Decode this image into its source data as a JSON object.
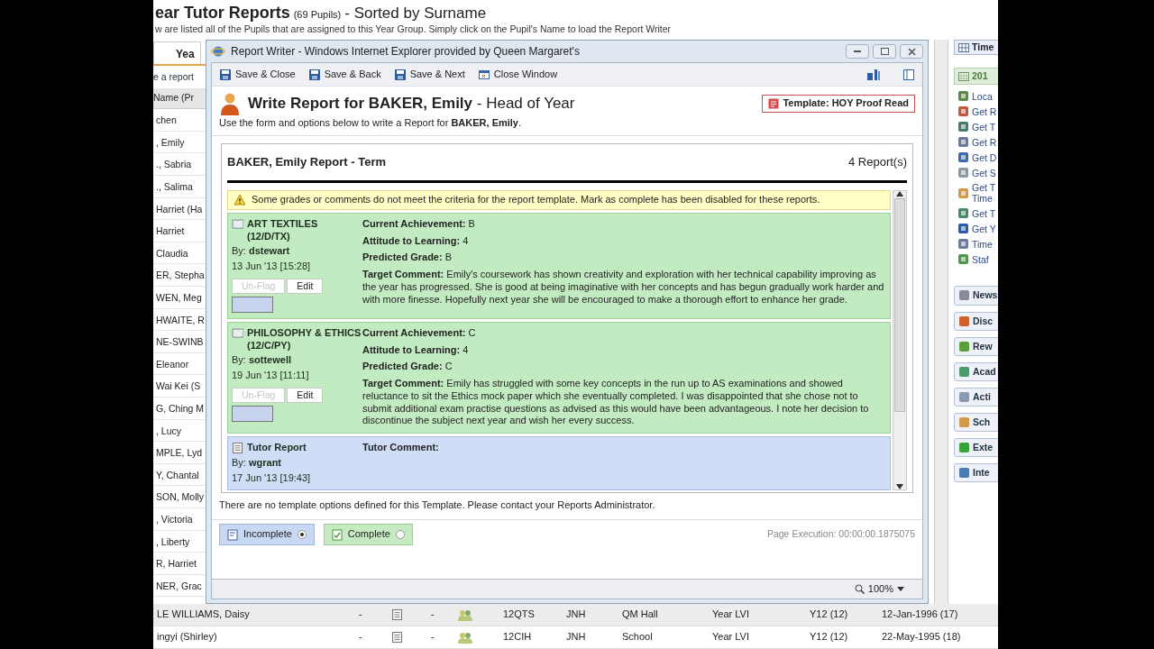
{
  "background_page": {
    "title": "ear Tutor Reports",
    "pupil_count": "(69 Pupils)",
    "sort_note": "- Sorted by Surname",
    "instructions": "w are listed all of the Pupils that are assigned to this Year Group. Simply click on the Pupil's Name to load the Report Writer",
    "tab": "Yea",
    "report_link": "e a report",
    "name_column": "Name (Pr",
    "names": [
      "chen",
      ", Emily",
      "., Sabria",
      "., Salima",
      "Harriet (Ha",
      "Harriet",
      "Claudia",
      "ER, Stepha",
      "WEN, Meg",
      "HWAITE, R",
      "NE-SWINB",
      "Eleanor",
      "Wai Kei (S",
      "G, Ching M",
      ", Lucy",
      "MPLE, Lyd",
      "Y, Chantal",
      "SON, Molly",
      ", Victoria",
      ", Liberty",
      "R, Harriet",
      "NER, Grac"
    ],
    "rows": [
      {
        "selected": true,
        "cells": [
          "LE WILLIAMS, Daisy",
          "-",
          "-",
          "12QTS",
          "JNH",
          "QM Hall",
          "Year LVI",
          "Y12 (12)",
          "12-Jan-1996 (17)"
        ]
      },
      {
        "selected": false,
        "cells": [
          "ingyi (Shirley)",
          "-",
          "-",
          "12CIH",
          "JNH",
          "School",
          "Year LVI",
          "Y12 (12)",
          "22-May-1995 (18)"
        ]
      }
    ]
  },
  "report_window": {
    "title": "Report Writer - Windows Internet Explorer provided by Queen Margaret's",
    "toolbar": [
      {
        "label": "Save & Close",
        "kind": "save"
      },
      {
        "label": "Save & Back",
        "kind": "save"
      },
      {
        "label": "Save & Next",
        "kind": "save"
      },
      {
        "label": "Close Window",
        "kind": "close"
      }
    ],
    "heading": "**Write Report for BAKER, Emily** - Head of Year",
    "template_button": "Template: HOY Proof Read",
    "intro": "Use the form and options below to write a Report for **BAKER, Emily**.",
    "report_panel": {
      "title": "BAKER, Emily Report - Term",
      "count": "4  Report(s)",
      "warning": "Some grades or comments do not meet the criteria for the report template. Mark as complete has been disabled for these reports.",
      "entries": [
        {
          "kind": "subject",
          "title": "ART TEXTILES (12/D/TX)",
          "by": "By: **dstewart**",
          "date": "13 Jun '13 [15:28]",
          "flag_button": {
            "label": "Un-Flag",
            "disabled": true
          },
          "edit_button": "Edit",
          "fields": [
            {
              "label": "Current Achievement:",
              "value": "B"
            },
            {
              "label": "Attitude to Learning:",
              "value": "4"
            },
            {
              "label": "Predicted Grade:",
              "value": "B"
            },
            {
              "label": "Target Comment:",
              "value": "Emily's coursework has shown creativity and exploration with her technical capability improving as the year has progressed. She is good at being imaginative with her concepts and has begun gradually work harder and with more finesse. Hopefully next year she will be encouraged to make a thorough effort to enhance her grade."
            }
          ]
        },
        {
          "kind": "subject",
          "title": "PHILOSOPHY & ETHICS (12/C/PY)",
          "by": "By: **sottewell**",
          "date": "19 Jun '13 [11:11]",
          "flag_button": {
            "label": "Un-Flag",
            "disabled": true
          },
          "edit_button": "Edit",
          "fields": [
            {
              "label": "Current Achievement:",
              "value": "C"
            },
            {
              "label": "Attitude to Learning:",
              "value": "4"
            },
            {
              "label": "Predicted Grade:",
              "value": "C"
            },
            {
              "label": "Target Comment:",
              "value": "Emily has struggled with some key concepts in the run up to AS examinations and showed reluctance to sit the Ethics mock paper which she eventually completed. I was disappointed that she chose not to submit additional exam practise questions as advised as this would have been advantageous. I note her decision to discontinue the subject next year and wish her every success."
            }
          ]
        },
        {
          "kind": "tutor",
          "title": "Tutor Report",
          "by": "By: **wgrant**",
          "date": "17 Jun '13 [19:43]",
          "fields": [
            {
              "label": "Tutor Comment:"
            }
          ]
        }
      ]
    },
    "template_note": "There are no template options defined for this Template. Please contact your Reports Administrator.",
    "status_options": [
      {
        "label": "Incomplete",
        "kind": "incomplete",
        "selected": true
      },
      {
        "label": "Complete",
        "kind": "complete",
        "selected": false
      }
    ],
    "page_execution": "Page Execution: 00:00:00.1875075",
    "zoom": "100%"
  },
  "sidebar": {
    "header": "Time",
    "calendar_item": "201",
    "links": [
      "Loca",
      "Get R",
      "Get T",
      "Get R",
      "Get D",
      "Get S",
      "Get T\nTime",
      "Get T",
      "Get Y",
      "Time",
      "Staf"
    ],
    "sections": [
      "News",
      "Disc",
      "Rew",
      "Acad",
      "Acti",
      "Sch",
      "Exte",
      "Inte"
    ]
  }
}
